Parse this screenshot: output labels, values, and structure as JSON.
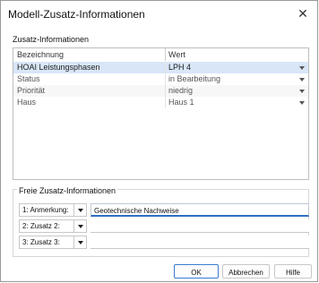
{
  "window": {
    "title": "Modell-Zusatz-Informationen"
  },
  "section": {
    "title": "Zusatz-Informationen"
  },
  "table": {
    "headers": [
      "Bezeichnung",
      "Wert"
    ],
    "rows": [
      {
        "name": "HOAI Leistungsphasen",
        "value": "LPH 4",
        "selected": true
      },
      {
        "name": "Status",
        "value": "in Bearbeitung",
        "selected": false
      },
      {
        "name": "Priorität",
        "value": "niedrig",
        "selected": false
      },
      {
        "name": "Haus",
        "value": "Haus 1",
        "selected": false
      }
    ]
  },
  "free_info": {
    "title": "Freie Zusatz-Informationen",
    "rows": [
      {
        "label": "1: Anmerkung:",
        "value": "Geotechnische Nachweise"
      },
      {
        "label": "2: Zusatz 2:",
        "value": ""
      },
      {
        "label": "3: Zusatz 3:",
        "value": ""
      }
    ]
  },
  "buttons": {
    "ok": "OK",
    "cancel": "Abbrechen",
    "help": "Hilfe"
  },
  "colors": {
    "selection": "#d8e6f7",
    "focus": "#2f6fc2"
  },
  "icons": {
    "close": "close-icon",
    "dropdown": "chevron-down-icon"
  }
}
